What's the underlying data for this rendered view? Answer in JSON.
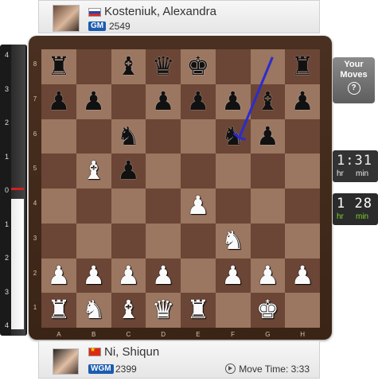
{
  "top_player": {
    "name": "Kosteniuk, Alexandra",
    "title": "GM",
    "rating": "2549",
    "flag": "ru"
  },
  "bottom_player": {
    "name": "Ni, Shiqun",
    "title": "WGM",
    "rating": "2399",
    "flag": "cn",
    "move_time_label": "Move Time: 3:33"
  },
  "your_moves": {
    "line1": "Your",
    "line2": "Moves",
    "help": "?"
  },
  "clock_top": {
    "time": "1:31",
    "hr": "hr",
    "min": "min"
  },
  "clock_bottom": {
    "time": "1 28",
    "hr": "hr",
    "min": "min"
  },
  "eval_bar": {
    "ticks": [
      "4",
      "3",
      "2",
      "1",
      "0",
      "1",
      "2",
      "3",
      "4"
    ],
    "white_share": 0.47
  },
  "board": {
    "files": [
      "A",
      "B",
      "C",
      "D",
      "E",
      "F",
      "G",
      "H"
    ],
    "ranks": [
      "8",
      "7",
      "6",
      "5",
      "4",
      "3",
      "2",
      "1"
    ],
    "pieces": {
      "a8": "bR",
      "c8": "bB",
      "d8": "bQ",
      "e8": "bK",
      "h8": "bR",
      "a7": "bP",
      "b7": "bP",
      "d7": "bP",
      "e7": "bP",
      "f7": "bP",
      "g7": "bB",
      "h7": "bP",
      "c6": "bN",
      "f6": "bN",
      "g6": "bP",
      "b5": "wB",
      "c5": "bP",
      "e4": "wP",
      "f3": "wN",
      "a2": "wP",
      "b2": "wP",
      "c2": "wP",
      "d2": "wP",
      "f2": "wP",
      "g2": "wP",
      "h2": "wP",
      "a1": "wR",
      "b1": "wN",
      "c1": "wB",
      "d1": "wQ",
      "e1": "wR",
      "g1": "wK"
    },
    "arrow": {
      "from": "g8",
      "to": "f6",
      "color": "#2b2bd0"
    }
  }
}
